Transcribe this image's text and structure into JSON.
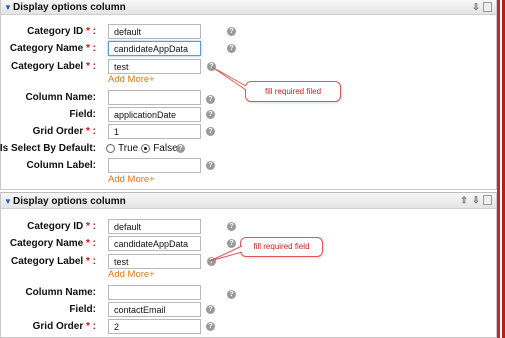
{
  "sections": [
    {
      "title": "Display options column",
      "fields": {
        "category_id": {
          "label": "Category ID",
          "value": "default"
        },
        "category_name": {
          "label": "Category Name",
          "value": "candidateAppData"
        },
        "category_label": {
          "label": "Category Label",
          "value": "test"
        },
        "add_more_1": "Add More+",
        "column_name": {
          "label": "Column Name:",
          "value": ""
        },
        "field": {
          "label": "Field:",
          "value": "applicationDate"
        },
        "grid_order": {
          "label": "Grid Order",
          "value": "1"
        },
        "is_select_by_default": {
          "label": "Is Select By Default:",
          "true_label": "True",
          "false_label": "False",
          "selected": "False"
        },
        "column_label": {
          "label": "Column Label:",
          "value": ""
        },
        "add_more_2": "Add More+"
      },
      "callout": "fill required filed"
    },
    {
      "title": "Display options column",
      "fields": {
        "category_id": {
          "label": "Category ID",
          "value": "default"
        },
        "category_name": {
          "label": "Category Name",
          "value": "candidateAppData"
        },
        "category_label": {
          "label": "Category Label",
          "value": "test"
        },
        "add_more_1": "Add More+",
        "column_name": {
          "label": "Column Name:",
          "value": ""
        },
        "field": {
          "label": "Field:",
          "value": "contactEmail"
        },
        "grid_order": {
          "label": "Grid Order",
          "value": "2"
        }
      },
      "callout": "fill required field"
    }
  ],
  "required_marker": " * :",
  "icons": {
    "collapse": "triangle-down-icon",
    "move_up": "arrow-up-icon",
    "move_down": "arrow-down-icon",
    "delete": "trash-icon",
    "help": "help-icon"
  },
  "colors": {
    "required": "#d01010",
    "add_more": "#e07a10",
    "callout_border": "#e05555",
    "callout_text": "#d02020",
    "accent_red": "#c62828"
  }
}
